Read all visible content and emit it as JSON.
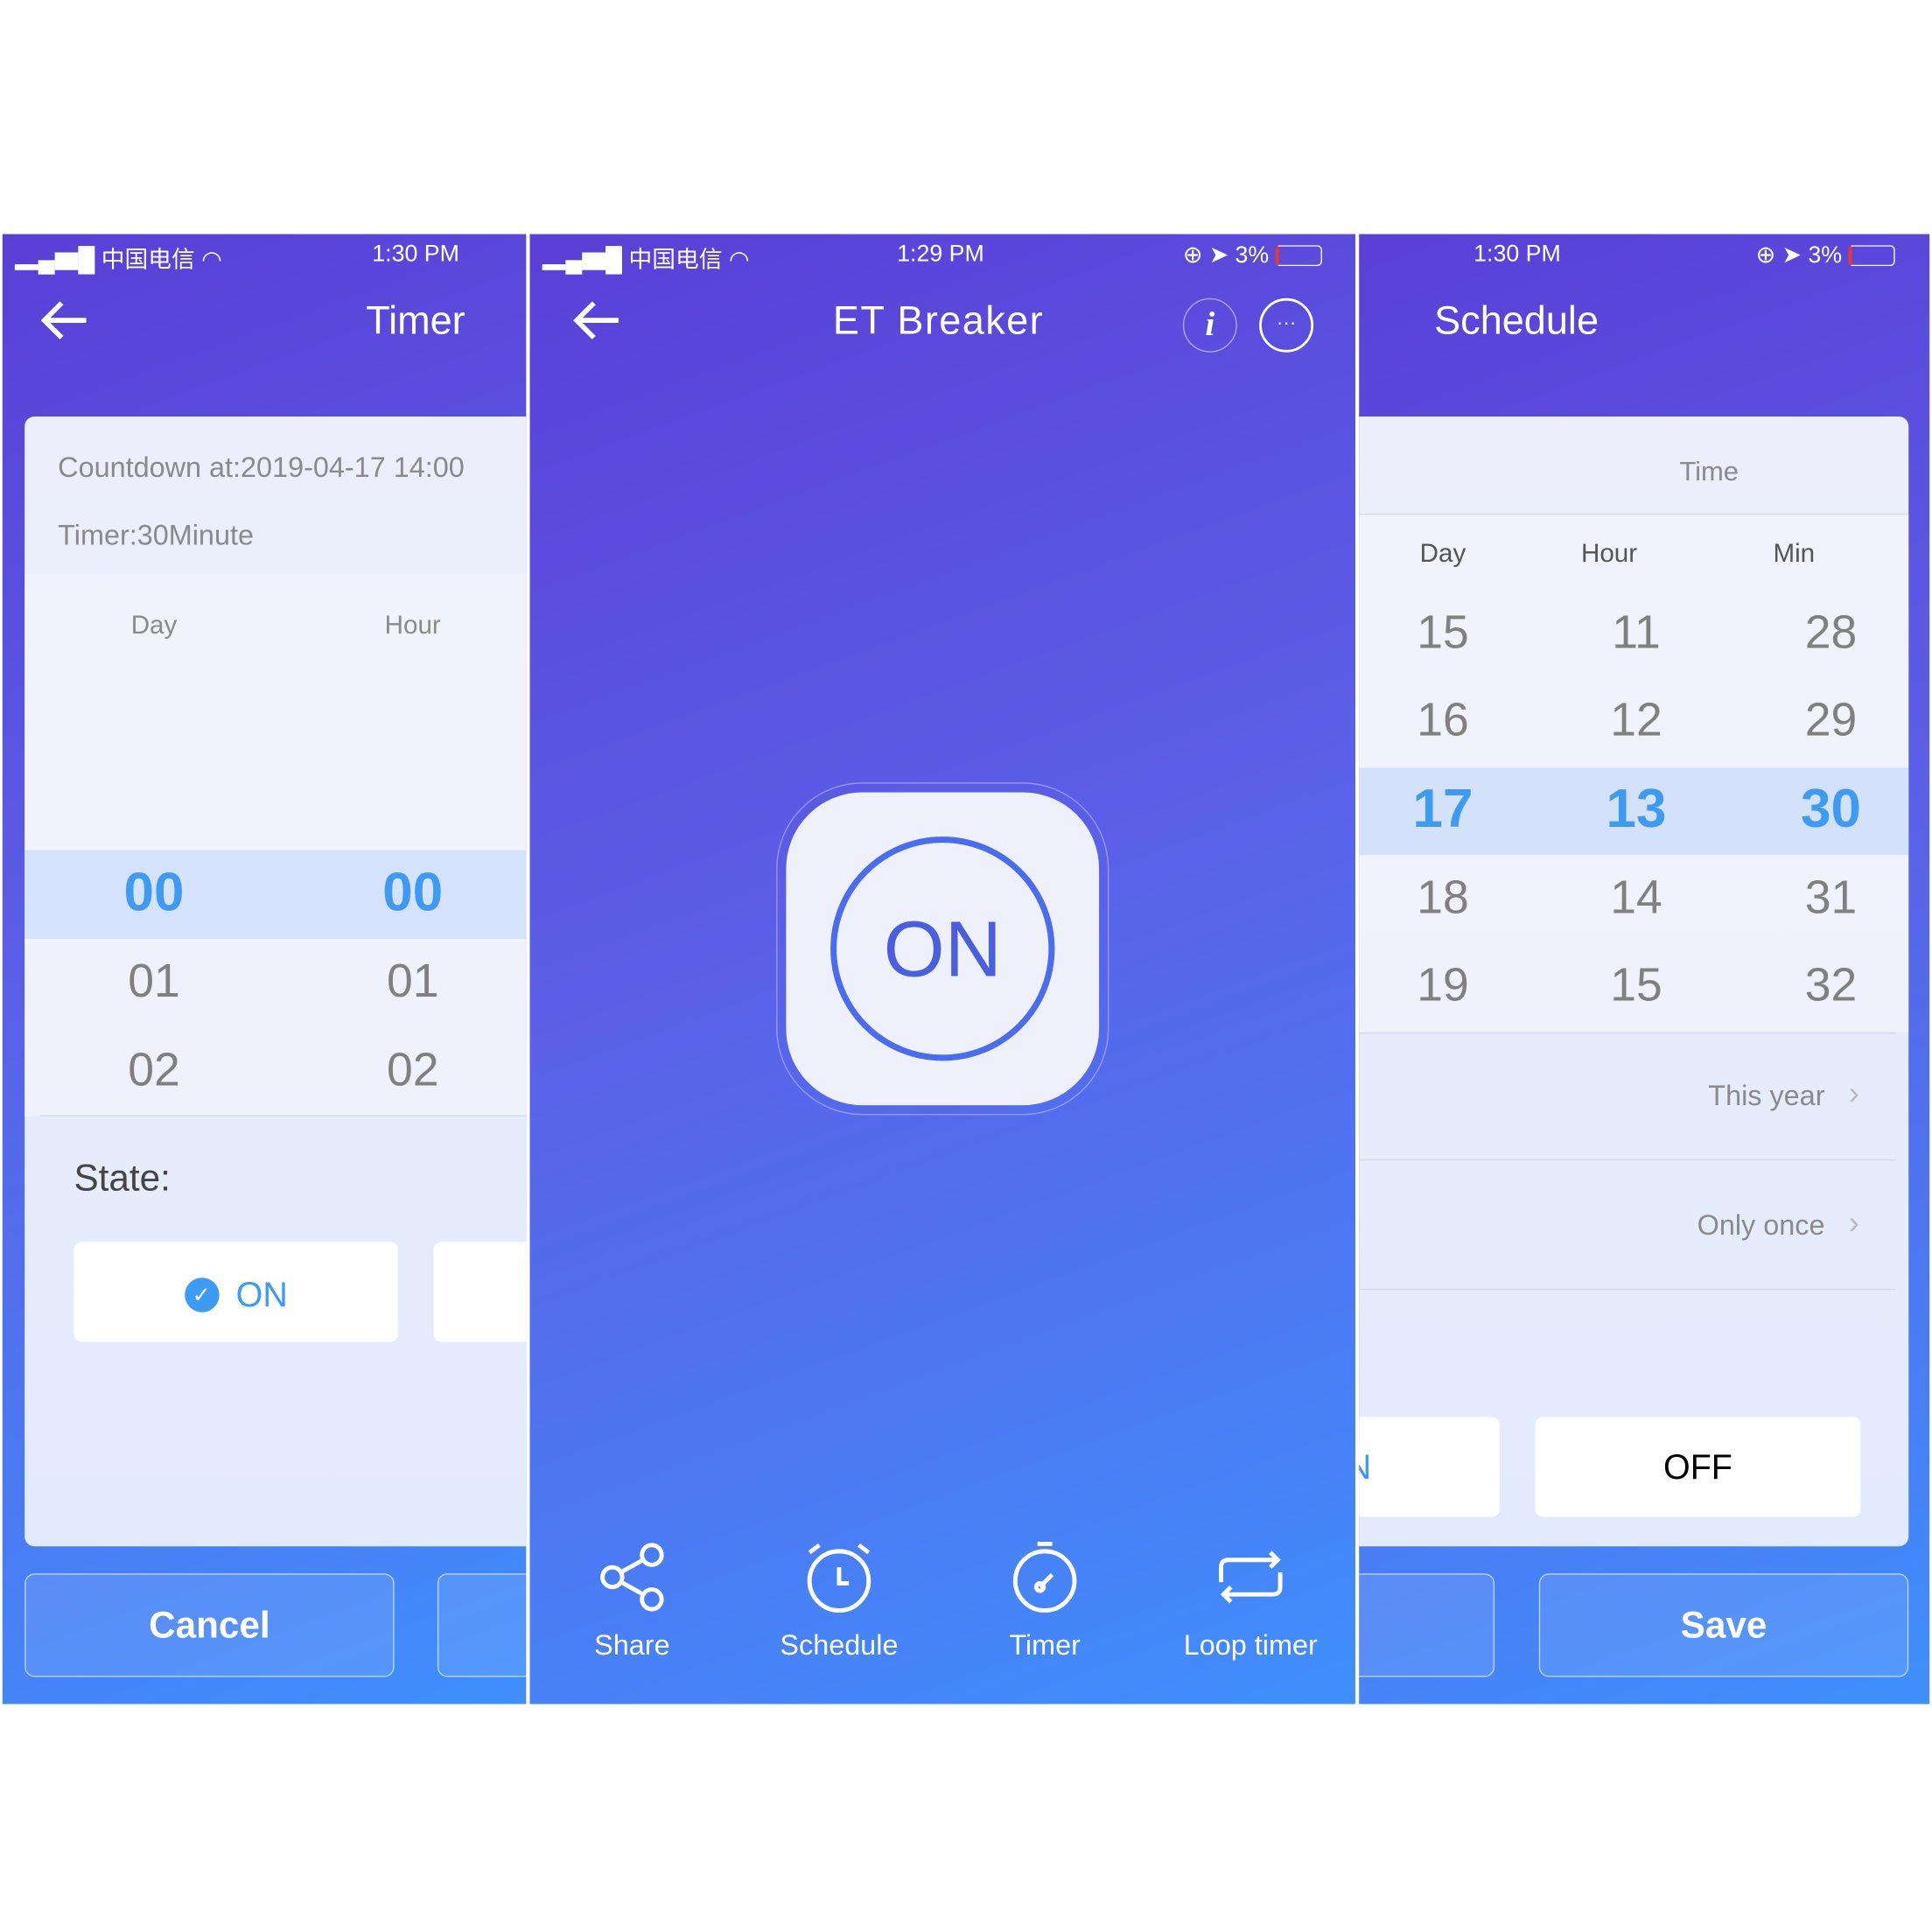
{
  "timer_screen": {
    "status": {
      "carrier": "中国电信",
      "time": "1:30 PM"
    },
    "title": "Timer",
    "countdown": "Countdown at:2019-04-17 14:00",
    "timer": "Timer:30Minute",
    "columns": [
      "Day",
      "Hour"
    ],
    "day_values": [
      "00",
      "01",
      "02"
    ],
    "hour_values": [
      "00",
      "01",
      "02"
    ],
    "state_label": "State:",
    "state_on": "ON",
    "cancel": "Cancel"
  },
  "device_screen": {
    "status": {
      "carrier": "中国电信",
      "time": "1:29 PM",
      "battery": "3%"
    },
    "title": "ET Breaker",
    "power_label": "ON",
    "tabs": [
      {
        "label": "Share",
        "icon": "share-icon"
      },
      {
        "label": "Schedule",
        "icon": "alarm-clock-icon"
      },
      {
        "label": "Timer",
        "icon": "stopwatch-icon"
      },
      {
        "label": "Loop timer",
        "icon": "loop-icon"
      }
    ]
  },
  "schedule_screen": {
    "status": {
      "time": "1:30 PM",
      "battery": "3%"
    },
    "title": "Schedule",
    "section": "Time",
    "columns": [
      "Day",
      "Hour",
      "Min"
    ],
    "days": [
      "15",
      "16",
      "17",
      "18",
      "19"
    ],
    "hours": [
      "11",
      "12",
      "13",
      "14",
      "15"
    ],
    "mins": [
      "28",
      "29",
      "30",
      "31",
      "32"
    ],
    "year": "This year",
    "repeat": "Only once",
    "on_partial": "ON",
    "off": "OFF",
    "cancel_partial": "l",
    "save": "Save"
  },
  "colors": {
    "accent": "#3d9af5",
    "battery_low": "#e53935"
  }
}
